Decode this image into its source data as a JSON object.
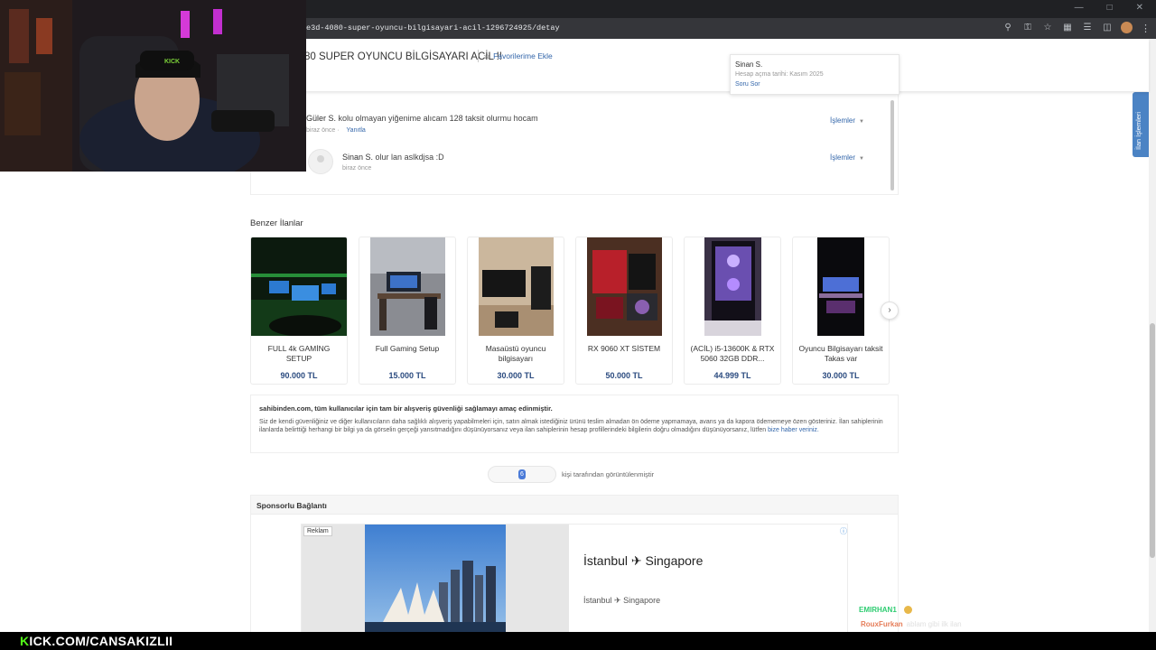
{
  "browser": {
    "url": "e3d-4080-super-oyuncu-bilgisayari-acil-1296724925/detay"
  },
  "header": {
    "title": "80 SUPER OYUNCU BİLGİSAYARI ACİL !!",
    "favorite_label": "Favorilerime Ekle"
  },
  "seller": {
    "name": "Sinan S.",
    "since": "Hesap açma tarihi: Kasım 2025",
    "ask_label": "Soru Sor"
  },
  "questions": [
    {
      "author": "Güler S.",
      "text": "kolu olmayan yiğenime alıcam 128 taksit olurmu hocam",
      "time": "biraz önce",
      "reply_label": "Yanıtla",
      "actions_label": "İşlemler"
    },
    {
      "author": "Sinan S.",
      "text": "olur lan aslkdjsa :D",
      "time": "biraz önce",
      "actions_label": "İşlemler"
    }
  ],
  "similar": {
    "heading": "Benzer İlanlar",
    "items": [
      {
        "title": "FULL 4k GAMİNG SETUP",
        "price": "90.000 TL"
      },
      {
        "title": "Full Gaming Setup",
        "price": "15.000 TL"
      },
      {
        "title": "Masaüstü oyuncu bilgisayarı",
        "price": "30.000 TL"
      },
      {
        "title": "RX 9060 XT SİSTEM",
        "price": "50.000 TL"
      },
      {
        "title": "(ACİL) i5-13600K & RTX 5060 32GB DDR...",
        "price": "44.999 TL"
      },
      {
        "title": "Oyuncu Bilgisayarı taksit Takas var",
        "price": "30.000 TL"
      }
    ]
  },
  "safety": {
    "title": "sahibinden.com, tüm kullanıcılar için tam bir alışveriş güvenliği sağlamayı amaç edinmiştir.",
    "body": "Siz de kendi güvenliğiniz ve diğer kullanıcıların daha sağlıklı alışveriş yapabilmeleri için, satın almak istediğiniz ürünü teslim almadan ön ödeme yapmamaya, avans ya da kapora ödememeye özen gösteriniz. İlan sahiplerinin ilanlarda belirttiği herhangi bir bilgi ya da görselin gerçeği yansıtmadığını düşünüyorsanız veya ilan sahiplerinin hesap profillerindeki bilgilerin doğru olmadığını düşünüyorsanız, lütfen ",
    "link": "bize haber veriniz."
  },
  "views": {
    "count": "6",
    "suffix": "kişi tarafından görüntülenmiştir"
  },
  "sponsored": {
    "title": "Sponsorlu Bağlantı",
    "ad_label": "Reklam",
    "headline": "İstanbul ✈ Singapore",
    "subline": "İstanbul ✈ Singapore"
  },
  "side_tab": "İlan İşlemleri",
  "stream": {
    "url_k": "K",
    "url_rest": "ICK.COM/CANSAKIZLII",
    "chat": [
      {
        "user": "EMIRHAN1"
      },
      {
        "user": "RouxFurkan",
        "message": "ablam gibi ilk ilan"
      }
    ]
  },
  "colors": {
    "link": "#3366aa",
    "price": "#2a4a7f",
    "kick_green": "#53fc18",
    "side_tab": "#4b83c4"
  }
}
